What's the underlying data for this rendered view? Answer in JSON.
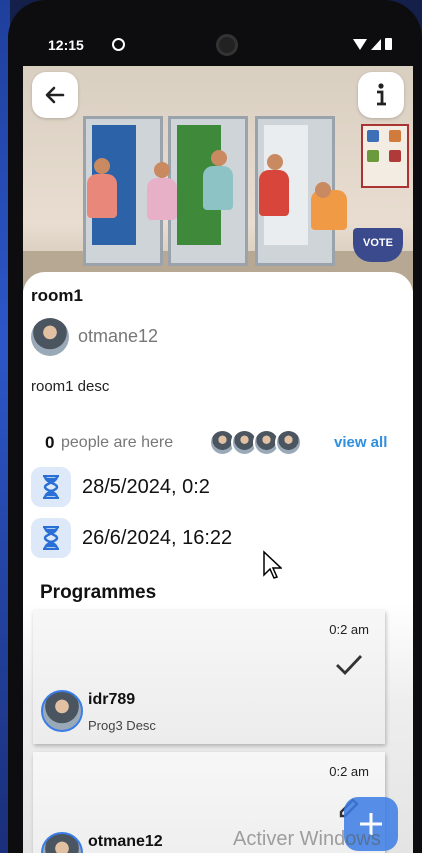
{
  "status_bar": {
    "time": "12:15"
  },
  "header": {
    "back_icon": "arrow-left-icon",
    "info_icon": "info-icon",
    "vote_label": "VOTE"
  },
  "room": {
    "title": "room1",
    "owner": "otmane12",
    "description": "room1 desc",
    "people_count": "0",
    "people_label": "people are here",
    "view_all": "view all",
    "start_date": "28/5/2024, 0:2",
    "end_date": "26/6/2024, 16:22"
  },
  "programmes": {
    "title": "Programmes",
    "items": [
      {
        "time": "0:2 am",
        "user": "idr789",
        "description": "Prog3 Desc",
        "status_icon": "check-icon"
      },
      {
        "time": "0:2 am",
        "user": "otmane12",
        "description": "",
        "status_icon": "edit-icon"
      }
    ]
  },
  "fab": {
    "icon": "plus-icon"
  },
  "watermark": "Activer Windows",
  "colors": {
    "accent": "#2f8fe0",
    "fab": "#3b7de6",
    "icon_bg": "#dde9f8"
  }
}
